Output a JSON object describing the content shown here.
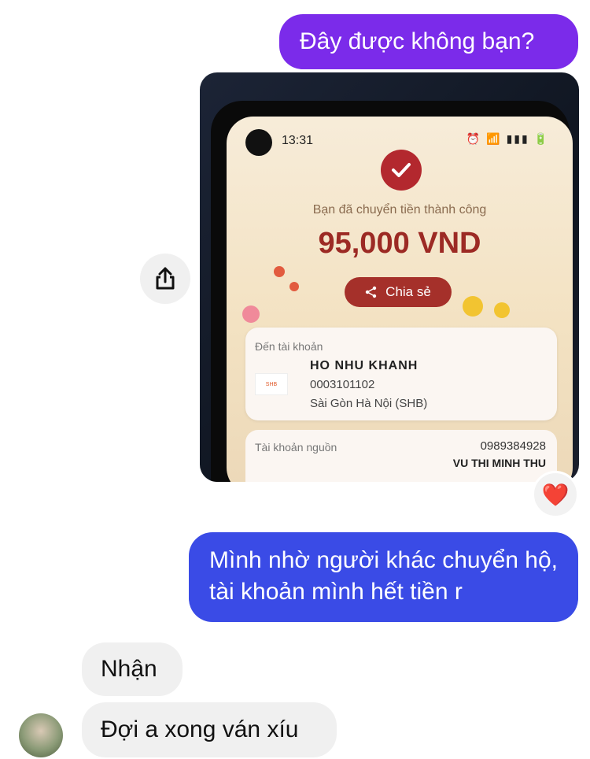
{
  "messages": {
    "out1": "Đây được không bạn?",
    "out2": "Mình nhờ người khác chuyển hộ, tài khoản mình hết tiền r",
    "in1": "Nhận",
    "in2": "Đợi a xong ván xíu"
  },
  "reaction": {
    "emoji": "❤️"
  },
  "screenshot": {
    "time": "13:31",
    "success_text": "Bạn đã chuyển tiền thành công",
    "amount": "95,000 VND",
    "share_label": "Chia sẻ",
    "to_account_label": "Đến tài khoản",
    "recipient_name": "HO NHU KHANH",
    "account_number": "0003101102",
    "bank_name": "Sài Gòn Hà Nội (SHB)",
    "bank_logo_text": "SHB",
    "source_label": "Tài khoản nguồn",
    "source_phone": "0989384928",
    "source_name": "VU THI MINH THU"
  },
  "colors": {
    "outgoing_purple": "#7b2bea",
    "outgoing_blue": "#3a4be6",
    "incoming_gray": "#f0f0f0",
    "accent_red": "#b3282e"
  }
}
